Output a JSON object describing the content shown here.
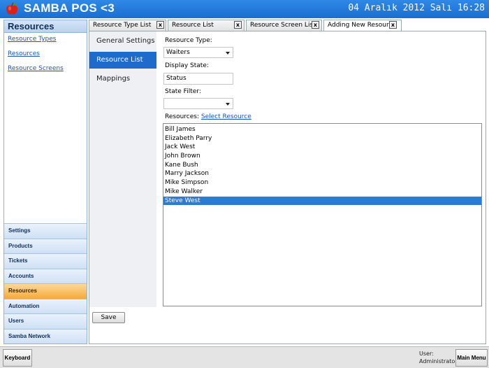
{
  "app": {
    "title": "SAMBA POS <3",
    "datetime": "04 Aralık 2012 Salı 16:28",
    "icon": "apple-icon"
  },
  "left_panel": {
    "title": "Resources",
    "links": [
      "Resource Types",
      "Resources",
      "Resource Screens"
    ],
    "nav_buttons": [
      "Settings",
      "Products",
      "Tickets",
      "Accounts",
      "Resources",
      "Automation",
      "Users",
      "Samba Network"
    ],
    "active_nav": "Resources"
  },
  "tabs": [
    {
      "label": "Resource Type List",
      "close": "x"
    },
    {
      "label": "Resource List",
      "close": "x"
    },
    {
      "label": "Resource Screen List",
      "close": "x"
    },
    {
      "label": "Adding New Resource",
      "close": "x"
    }
  ],
  "sub_nav": [
    "General Settings",
    "Resource List",
    "Mappings"
  ],
  "form": {
    "resource_type_label": "Resource Type:",
    "resource_type_value": "Waiters",
    "display_state_label": "Display State:",
    "display_state_value": "Status",
    "state_filter_label": "State Filter:",
    "state_filter_value": "",
    "resources_label": "Resources:",
    "select_resource_link": "Select Resource"
  },
  "resources": [
    "Bill James",
    "Elizabeth Parry",
    "Jack West",
    "John Brown",
    "Kane Bush",
    "Marry Jackson",
    "Mike Simpson",
    "Mike Walker",
    "Steve West"
  ],
  "selected_resource": "Steve West",
  "save_label": "Save",
  "bottom": {
    "keyboard_label": "Keyboard",
    "user_label": "User:",
    "user_name": "Administrator",
    "main_menu_label": "Main Menu"
  },
  "colors": {
    "title_bar": "#1a6fd0",
    "active_nav": "#f5a93a",
    "selection": "#2b7ad6",
    "sub_nav_selected": "#1f6bcc"
  }
}
